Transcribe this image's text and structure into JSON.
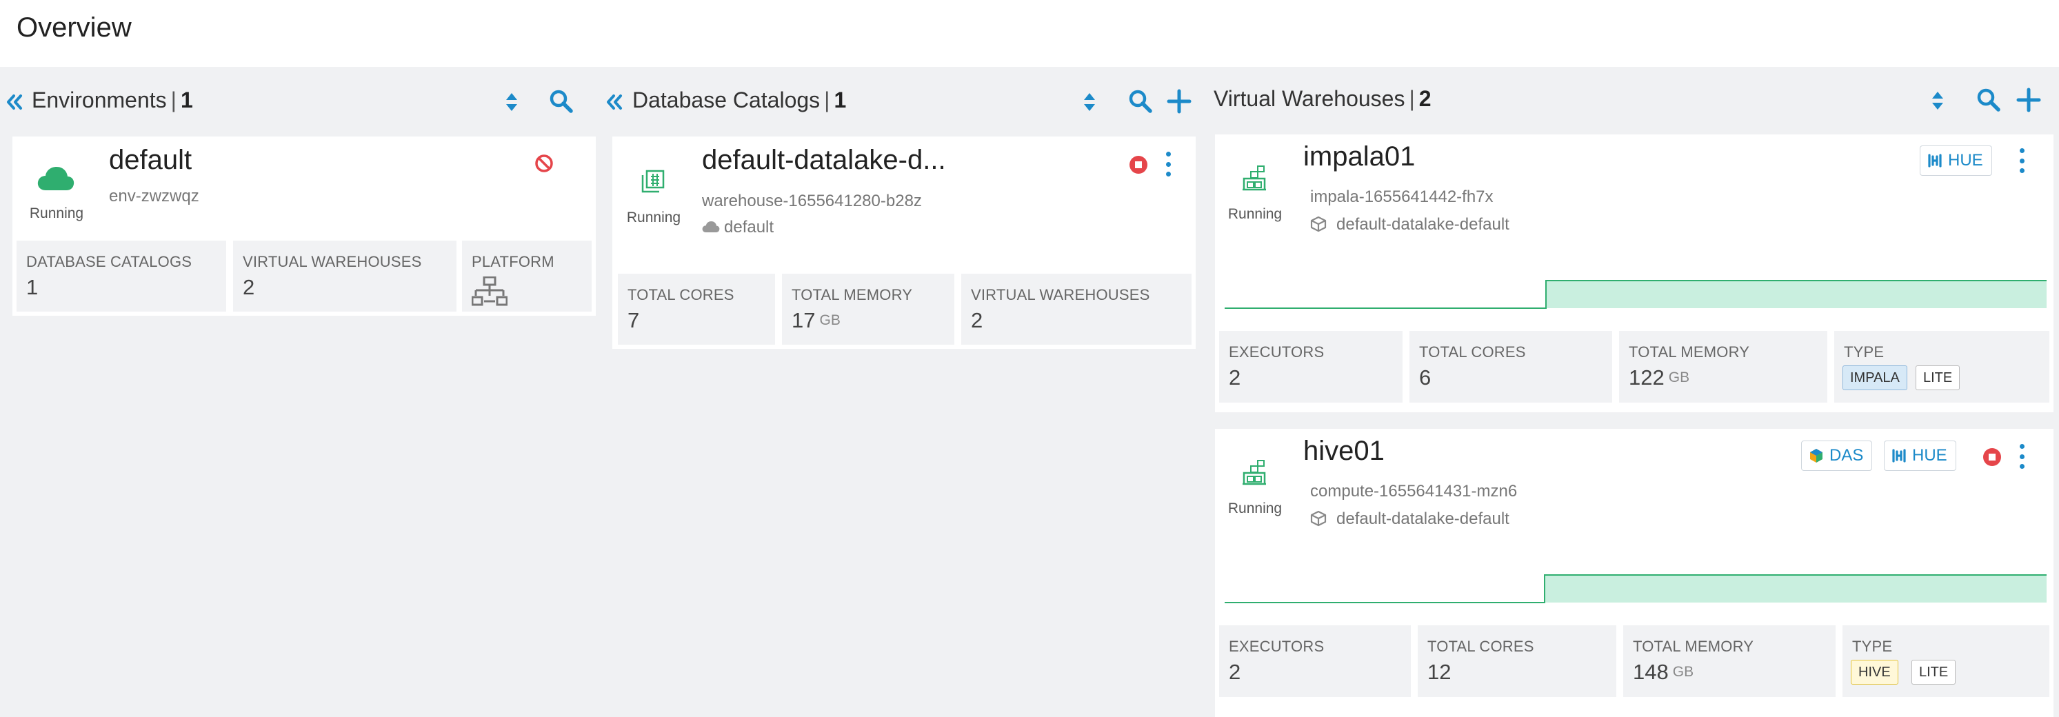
{
  "page": {
    "title": "Overview"
  },
  "colors": {
    "accent": "#1c8ac9",
    "running_green": "#2fae6f",
    "stop_red": "#e5454a",
    "chart_fill": "#c9efdf"
  },
  "environments": {
    "title": "Environments",
    "separator": "|",
    "count": "1",
    "cards": [
      {
        "name": "default",
        "id": "env-zwzwqz",
        "status": "Running",
        "icon": "cloud-icon",
        "stats": [
          {
            "label": "DATABASE CATALOGS",
            "value": "1"
          },
          {
            "label": "VIRTUAL WAREHOUSES",
            "value": "2"
          },
          {
            "label": "PLATFORM",
            "icon": "network-icon"
          }
        ]
      }
    ]
  },
  "catalogs": {
    "title": "Database Catalogs",
    "separator": "|",
    "count": "1",
    "cards": [
      {
        "name": "default-datalake-d...",
        "id": "warehouse-1655641280-b28z",
        "env": "default",
        "status": "Running",
        "stats": [
          {
            "label": "TOTAL CORES",
            "value": "7"
          },
          {
            "label": "TOTAL MEMORY",
            "value": "17",
            "unit": "GB"
          },
          {
            "label": "VIRTUAL WAREHOUSES",
            "value": "2"
          }
        ]
      }
    ]
  },
  "warehouses": {
    "title": "Virtual Warehouses",
    "separator": "|",
    "count": "2",
    "cards": [
      {
        "name": "impala01",
        "id": "impala-1655641442-fh7x",
        "catalog": "default-datalake-default",
        "status": "Running",
        "buttons": [
          "HUE"
        ],
        "stats": [
          {
            "label": "EXECUTORS",
            "value": "2"
          },
          {
            "label": "TOTAL CORES",
            "value": "6"
          },
          {
            "label": "TOTAL MEMORY",
            "value": "122",
            "unit": "GB"
          },
          {
            "label": "TYPE",
            "tags": [
              "IMPALA",
              "LITE"
            ]
          }
        ]
      },
      {
        "name": "hive01",
        "id": "compute-1655641431-mzn6",
        "catalog": "default-datalake-default",
        "status": "Running",
        "buttons": [
          "DAS",
          "HUE"
        ],
        "stats": [
          {
            "label": "EXECUTORS",
            "value": "2"
          },
          {
            "label": "TOTAL CORES",
            "value": "12"
          },
          {
            "label": "TOTAL MEMORY",
            "value": "148",
            "unit": "GB"
          },
          {
            "label": "TYPE",
            "tags": [
              "HIVE",
              "LITE"
            ]
          }
        ]
      }
    ]
  }
}
